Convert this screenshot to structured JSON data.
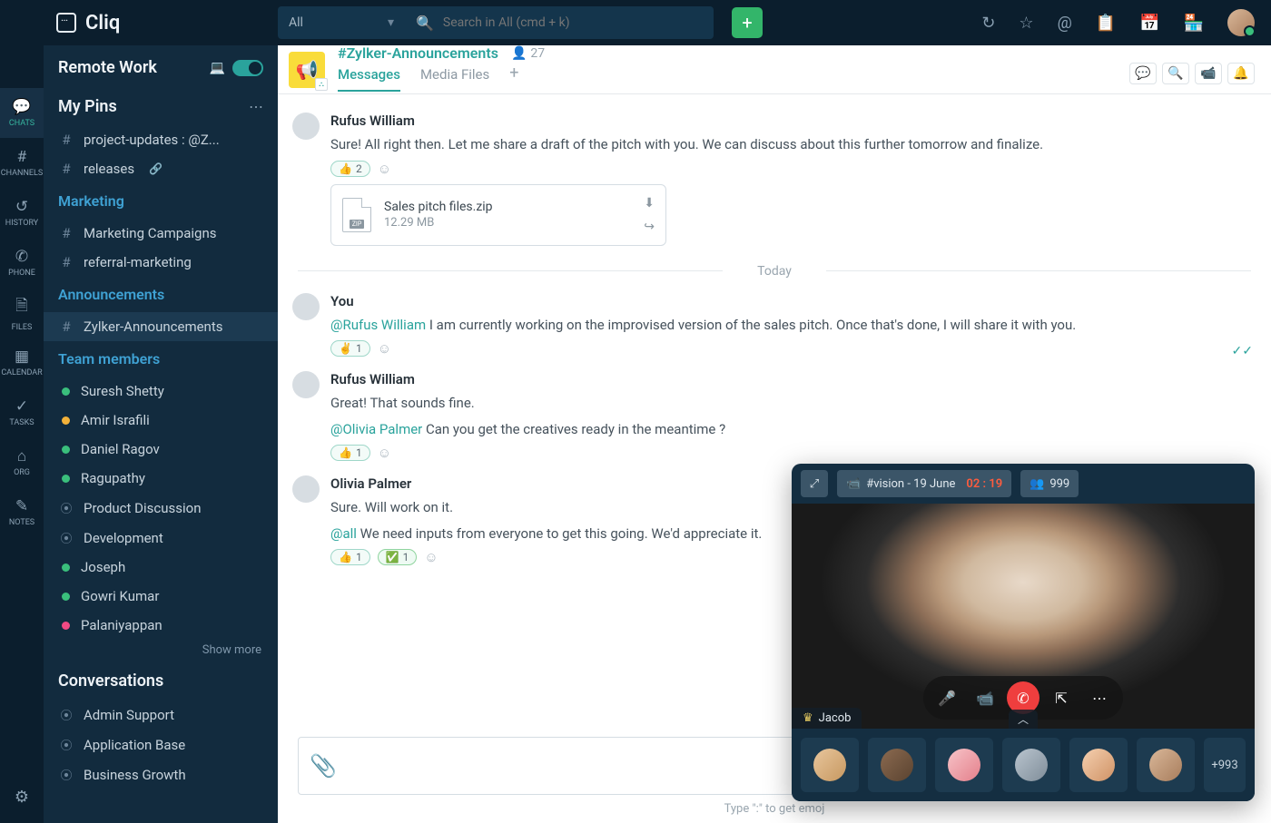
{
  "app": {
    "name": "Cliq"
  },
  "search": {
    "scope": "All",
    "placeholder": "Search in All (cmd + k)"
  },
  "rail": {
    "items": [
      {
        "id": "chats",
        "label": "CHATS",
        "icon": "💬"
      },
      {
        "id": "channels",
        "label": "CHANNELS",
        "icon": "#"
      },
      {
        "id": "history",
        "label": "HISTORY",
        "icon": "↺"
      },
      {
        "id": "phone",
        "label": "PHONE",
        "icon": "✆"
      },
      {
        "id": "files",
        "label": "FILES",
        "icon": "🗎"
      },
      {
        "id": "calendar",
        "label": "CALENDAR",
        "icon": "▦"
      },
      {
        "id": "tasks",
        "label": "TASKS",
        "icon": "✓"
      },
      {
        "id": "org",
        "label": "ORG",
        "icon": "⌂"
      },
      {
        "id": "notes",
        "label": "NOTES",
        "icon": "✎"
      }
    ]
  },
  "sidebar": {
    "workspace": "Remote Work",
    "pins_label": "My Pins",
    "pins": [
      {
        "label": "project-updates : @Z..."
      },
      {
        "label": "releases",
        "link": true
      }
    ],
    "sections": [
      {
        "title": "Marketing",
        "items": [
          {
            "label": "Marketing Campaigns"
          },
          {
            "label": "referral-marketing"
          }
        ]
      },
      {
        "title": "Announcements",
        "items": [
          {
            "label": "Zylker-Announcements",
            "active": true
          }
        ]
      },
      {
        "title": "Team members",
        "members": [
          {
            "name": "Suresh Shetty",
            "status": "green"
          },
          {
            "name": "Amir Israfili",
            "status": "yellow"
          },
          {
            "name": "Daniel Ragov",
            "status": "green"
          },
          {
            "name": "Ragupathy",
            "status": "green"
          },
          {
            "name": "Product Discussion",
            "group": true
          },
          {
            "name": "Development",
            "group": true
          },
          {
            "name": "Joseph",
            "status": "green"
          },
          {
            "name": "Gowri Kumar",
            "status": "green"
          },
          {
            "name": "Palaniyappan",
            "status": "pink"
          }
        ],
        "show_more": "Show more"
      }
    ],
    "conversations_label": "Conversations",
    "conversations": [
      {
        "label": "Admin Support"
      },
      {
        "label": "Application Base"
      },
      {
        "label": "Business Growth"
      }
    ]
  },
  "channel": {
    "name": "#Zylker-Announcements",
    "members": "27",
    "tabs": {
      "messages": "Messages",
      "media": "Media Files"
    },
    "divider": "Today",
    "messages": [
      {
        "author": "Rufus William",
        "text": "Sure! All right then. Let me share a draft of the pitch with you. We can discuss about this further tomorrow and finalize.",
        "react_emoji": "👍",
        "react_count": "2",
        "attachment": {
          "name": "Sales pitch files.zip",
          "size": "12.29 MB",
          "type": "ZIP"
        }
      },
      {
        "author": "You",
        "mention": "@Rufus William",
        "text": " I am currently working on the improvised version of the sales pitch. Once that's done, I will share it with you.",
        "react_emoji": "✌️",
        "react_count": "1"
      },
      {
        "author": "Rufus William",
        "text": "Great! That sounds fine.",
        "mention": "@Olivia Palmer",
        "text2": " Can you get the creatives ready in the meantime ?",
        "react_emoji": "👍",
        "react_count": "1"
      },
      {
        "author": "Olivia Palmer",
        "text": "Sure. Will work on it.",
        "mention": "@all",
        "text2": " We need inputs from everyone to get this going. We'd appreciate it.",
        "react_emoji": "👍",
        "react_count": "1",
        "react2_emoji": "✅",
        "react2_count": "1"
      }
    ]
  },
  "composer": {
    "tip": "Type \":\" to get emoj"
  },
  "video": {
    "title": "#vision - 19 June",
    "time": "02 : 19",
    "participants": "999",
    "speaker": "Jacob",
    "overflow": "+993"
  }
}
